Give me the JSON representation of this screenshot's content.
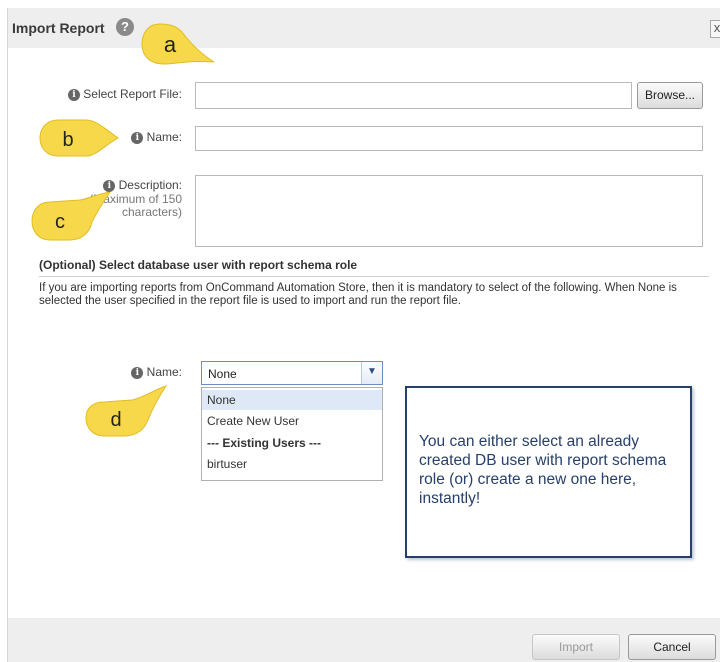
{
  "dialog": {
    "title": "Import Report",
    "help_icon": "?",
    "close_icon": "x"
  },
  "form": {
    "report_file_label": "Select Report File:",
    "report_file_value": "",
    "browse_label": "Browse...",
    "name_label": "Name:",
    "name_value": "",
    "description_label": "Description:",
    "description_note": "(Maximum of 150 characters)",
    "description_value": ""
  },
  "db_user_section": {
    "title": "(Optional) Select database user with report schema role",
    "text": "If you are importing reports from OnCommand Automation Store, then it is mandatory to select of the following. When None is selected the user specified in the report file is used to import and run the report file.",
    "name_label": "Name:",
    "selected": "None",
    "options": [
      {
        "label": "None"
      },
      {
        "label": "Create New User"
      },
      {
        "label": "--- Existing Users ---"
      },
      {
        "label": "birtuser"
      }
    ]
  },
  "annotations": {
    "a": "a",
    "b": "b",
    "c": "c",
    "d": "d",
    "callout": "You can either select an already created DB user with report schema role (or) create a new one here, instantly!"
  },
  "footer": {
    "import_label": "Import",
    "cancel_label": "Cancel"
  },
  "icons": {
    "info": "info-icon",
    "help": "help-icon",
    "close": "close-icon",
    "dropdown_arrow": "chevron-down-icon"
  },
  "colors": {
    "bubble_fill": "#f7d84a",
    "callout_border": "#27406b",
    "selected_option": "#dfe8f6"
  }
}
